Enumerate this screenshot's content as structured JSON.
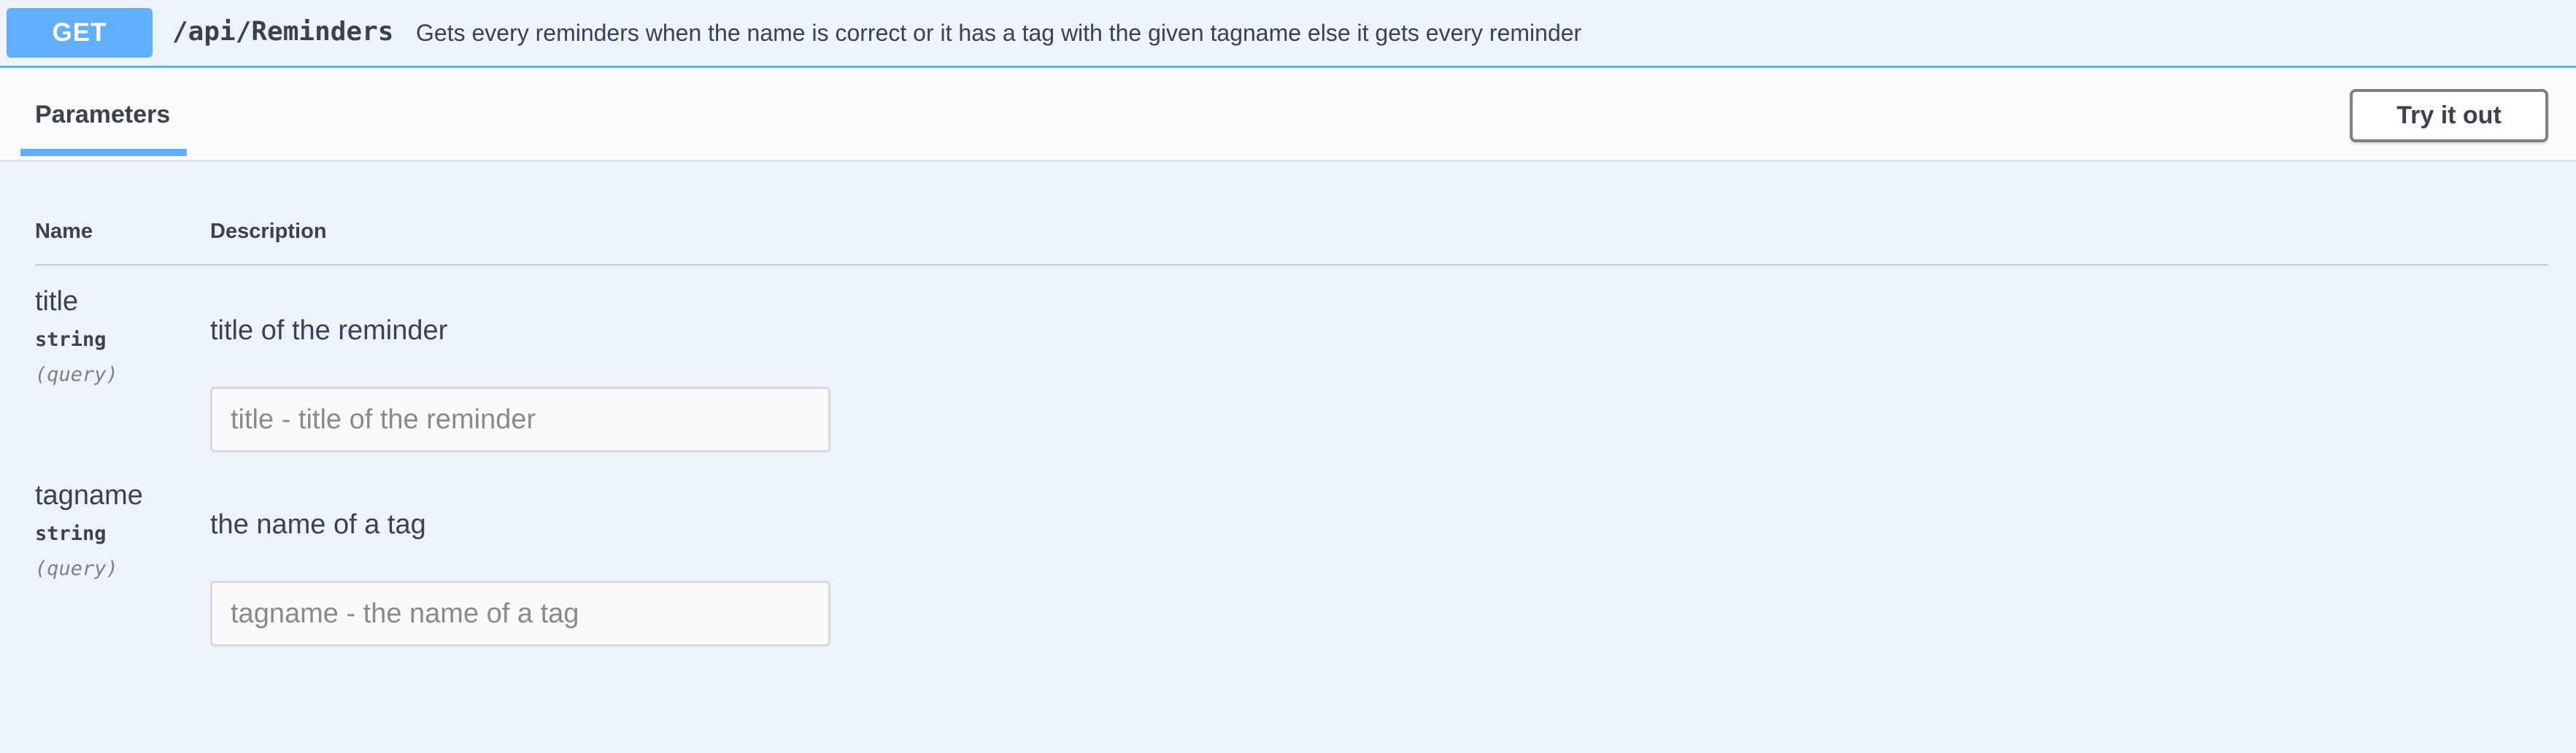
{
  "operation": {
    "method": "GET",
    "path": "/api/Reminders",
    "description": "Gets every reminders when the name is correct or it has a tag with the given tagname else it gets every reminder",
    "method_color": "#61affe"
  },
  "tabs": {
    "parameters_label": "Parameters",
    "try_it_out_label": "Try it out"
  },
  "table": {
    "headers": {
      "name": "Name",
      "description": "Description"
    }
  },
  "parameters": [
    {
      "name": "title",
      "type": "string",
      "in": "(query)",
      "description": "title of the reminder",
      "placeholder": "title - title of the reminder",
      "value": ""
    },
    {
      "name": "tagname",
      "type": "string",
      "in": "(query)",
      "description": "the name of a tag",
      "placeholder": "tagname - the name of a tag",
      "value": ""
    }
  ]
}
